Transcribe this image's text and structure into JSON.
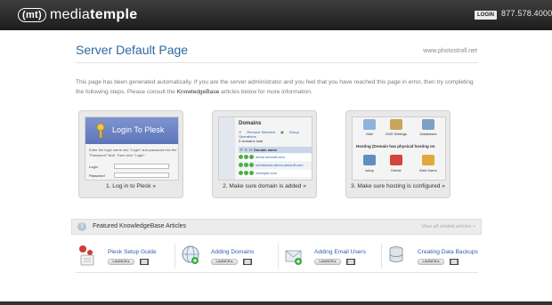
{
  "header": {
    "logo_mark": "(mt)",
    "logo_text_light": "media",
    "logo_text_bold": "temple",
    "login_label": "LOGIN",
    "phone": "877.578.4000"
  },
  "page": {
    "title": "Server Default Page",
    "site_url": "www.photostroll.net",
    "intro_part1": "This page has been generated automatically. If you are the server administrator and you feel that you have reached this page in error, then try completing the following steps. Please consult the ",
    "intro_link": "KnowledgeBase",
    "intro_part2": " articles below for more information."
  },
  "steps": [
    {
      "caption": "1. Log in to Plesk »",
      "mock": {
        "title": "Login To Plesk",
        "text": "Enter the login name into \"Login\" and password into the \"Password\" field. Then click \"Login\".",
        "login_label": "Login",
        "password_label": "Password"
      }
    },
    {
      "caption": "2. Make sure domain is added »",
      "mock": {
        "title": "Domains",
        "remove": "Remove Selected",
        "group_ops": "Group Operations",
        "count": "3 domains total",
        "column_p": "P",
        "column_s": "S",
        "column_h": "H",
        "column_name": "Domain name",
        "rows": [
          "demo.seesoft.com",
          "subdomain.demo.seesoft.com",
          "example.com"
        ]
      }
    },
    {
      "caption": "3. Make sure hosting is configured »",
      "mock": {
        "top_labels": [
          "Mail",
          "DNS Settings",
          "Databases"
        ],
        "hosting_title": "Hosting (Domain has physical hosting on",
        "bottom_labels": [
          "setup",
          "Delete",
          "Web Users"
        ]
      }
    }
  ],
  "kb": {
    "title": "Featured KnowledgeBase Articles",
    "view_all": "View all related articles »",
    "launch_label": "LAUNCH ▸",
    "articles": [
      {
        "title": "Plesk Setup Guide"
      },
      {
        "title": "Adding Domains"
      },
      {
        "title": "Adding Email Users"
      },
      {
        "title": "Creating Data Backups"
      }
    ]
  },
  "colors": {
    "title_blue": "#2b6aa0",
    "link_blue": "#2b5fa8",
    "topbar": "#1d1d1d"
  }
}
